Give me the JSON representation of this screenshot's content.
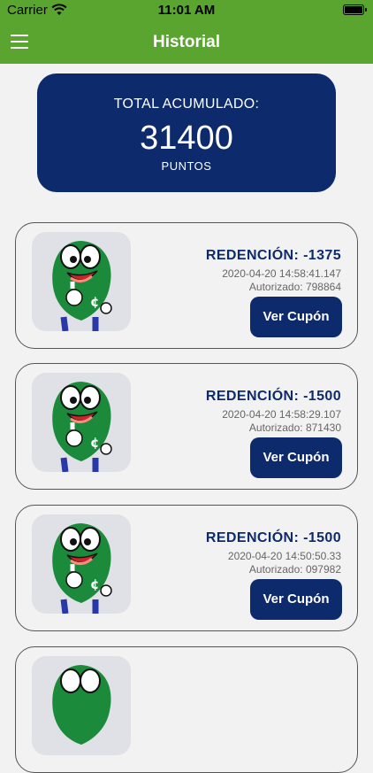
{
  "status": {
    "carrier": "Carrier",
    "time": "11:01 AM"
  },
  "nav": {
    "title": "Historial"
  },
  "total": {
    "label": "TOTAL ACUMULADO:",
    "value": "31400",
    "unit": "PUNTOS"
  },
  "records": [
    {
      "title": "REDENCIÓN: -1375",
      "date": "2020-04-20 14:58:41.147",
      "auth": "Autorizado: 798864",
      "button": "Ver Cupón"
    },
    {
      "title": "REDENCIÓN: -1500",
      "date": "2020-04-20 14:58:29.107",
      "auth": "Autorizado: 871430",
      "button": "Ver Cupón"
    },
    {
      "title": "REDENCIÓN: -1500",
      "date": "2020-04-20 14:50:50.33",
      "auth": "Autorizado: 097982",
      "button": "Ver Cupón"
    }
  ],
  "colors": {
    "header": "#5aa52f",
    "navy": "#0d2a6c",
    "mascot": "#1b8a3a"
  }
}
